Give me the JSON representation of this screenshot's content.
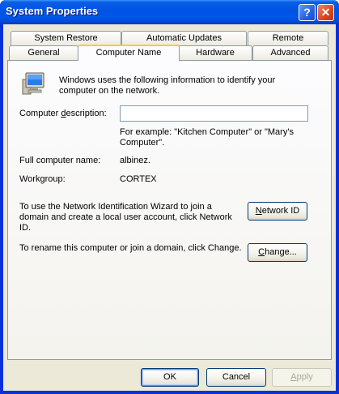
{
  "window": {
    "title": "System Properties",
    "help_glyph": "?",
    "close_glyph": "✕"
  },
  "tabs": {
    "row1": [
      {
        "label": "System Restore"
      },
      {
        "label": "Automatic Updates"
      },
      {
        "label": "Remote"
      }
    ],
    "row2": [
      {
        "label": "General"
      },
      {
        "label": "Computer Name",
        "active": true
      },
      {
        "label": "Hardware"
      },
      {
        "label": "Advanced"
      }
    ]
  },
  "computer_name": {
    "intro": "Windows uses the following information to identify your computer on the network.",
    "description_label_pre": "Computer ",
    "description_label_key": "d",
    "description_label_post": "escription:",
    "description_value": "",
    "example": "For example: \"Kitchen Computer\" or \"Mary's Computer\".",
    "full_name_label": "Full computer name:",
    "full_name_value": "albinez.",
    "workgroup_label": "Workgroup:",
    "workgroup_value": "CORTEX",
    "wizard_text": "To use the Network Identification Wizard to join a domain and create a local user account, click Network ID.",
    "network_id_pre": "",
    "network_id_key": "N",
    "network_id_post": "etwork ID",
    "rename_text": "To rename this computer or join a domain, click Change.",
    "change_pre": "",
    "change_key": "C",
    "change_post": "hange..."
  },
  "footer": {
    "ok_label": "OK",
    "cancel_label": "Cancel",
    "apply_pre": "",
    "apply_key": "A",
    "apply_post": "pply"
  },
  "colors": {
    "titlebar": "#0054e3",
    "dialog_face": "#ece9d8",
    "active_tab_highlight": "#ffc83c",
    "button_border": "#003c74"
  },
  "icons": {
    "help": "help-icon",
    "close": "close-icon",
    "computer": "computer-monitor-icon"
  }
}
